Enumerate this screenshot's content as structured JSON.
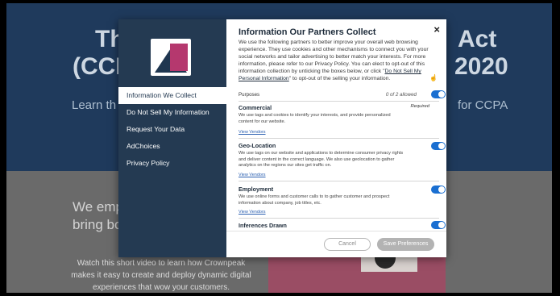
{
  "background": {
    "hero_left_line1": "Th",
    "hero_left_line2": "(CCP",
    "hero_right_line1": "Act",
    "hero_right_line2": "2020",
    "hero_sub_left": "Learn th",
    "hero_sub_right": "for CCPA",
    "emp_line1": "We emp",
    "emp_line2": "bring bo",
    "paragraph": "Watch this short video to learn how Crownpeak makes it easy to create and deploy dynamic digital experiences that wow your customers."
  },
  "sidebar": {
    "items": [
      {
        "label": "Information We Collect"
      },
      {
        "label": "Do Not Sell My Information"
      },
      {
        "label": "Request Your Data"
      },
      {
        "label": "AdChoices"
      },
      {
        "label": "Privacy Policy"
      }
    ]
  },
  "modal": {
    "title": "Information Our Partners Collect",
    "close": "×",
    "intro_text": "We use the following partners to better improve your overall web browsing experience. They use cookies and other mechanisms to connect you with your social networks and tailor advertising to better match your interests. For more information, please refer to our Privacy Policy. You can elect to opt-out of this information collection by unticking the boxes below, or click \"",
    "intro_link": "Do Not Sell My Personal Information",
    "intro_end": "\" to opt-out of the selling your information.",
    "purposes_label": "Purposes",
    "purposes_count": "0 of 2 allowed",
    "sections": [
      {
        "title": "Commercial",
        "required": "Required",
        "desc": "We use tags and cookies to identify your interests, and provide personalized content for our website.",
        "link": "View Vendors"
      },
      {
        "title": "Geo-Location",
        "desc": "We use tags on our website and applications to determine consumer privacy rights and deliver content in the correct language. We also use geolocation to gather analytics on the regions our sites get traffic on.",
        "link": "View Vendors"
      },
      {
        "title": "Employment",
        "desc": "We use online forms and customer calls to to gather customer and prospect information about company, job titles, etc.",
        "link": "View Vendors"
      },
      {
        "title": "Inferences Drawn"
      }
    ],
    "cancel_label": "Cancel",
    "save_label": "Save Preferences"
  }
}
